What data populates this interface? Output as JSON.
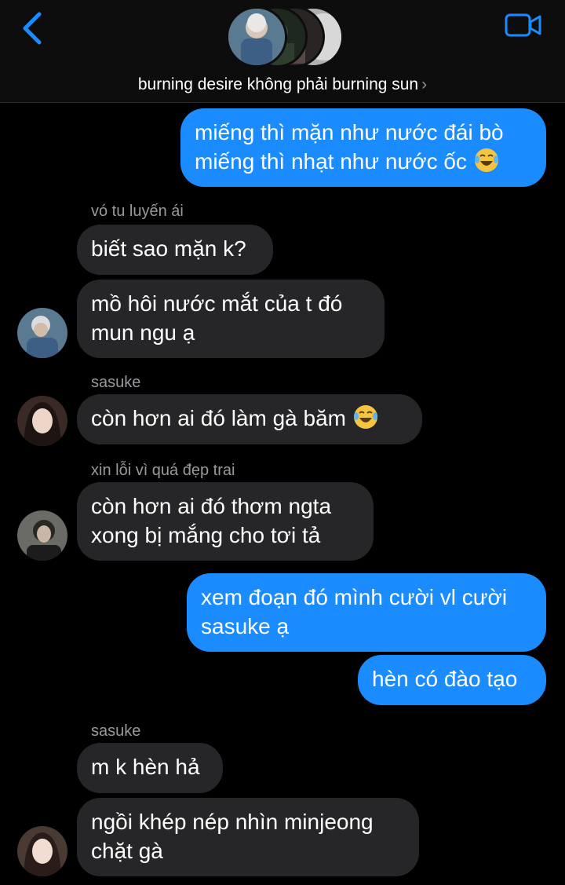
{
  "header": {
    "title": "burning desire không phải burning sun",
    "chevron": "›",
    "back_icon": "chevron-left-icon",
    "video_icon": "video-camera-icon",
    "accent": "#1a8cff"
  },
  "messages": [
    {
      "type": "sent",
      "lines": [
        "miếng thì mặn như nước đái bò",
        "miếng thì nhạt như nước ốc"
      ],
      "emoji": "laughing-tears-emoji"
    },
    {
      "type": "recv",
      "sender": "vó tu luyến ái",
      "text": "biết sao mặn k?"
    },
    {
      "type": "recv",
      "lines": [
        "mồ hôi nước mắt của t đó",
        "mun ngu ạ"
      ]
    },
    {
      "type": "recv",
      "sender": "sasuke",
      "text": "còn hơn ai đó làm gà băm",
      "emoji": "laughing-tears-emoji"
    },
    {
      "type": "recv",
      "sender": "xin lỗi vì quá đẹp trai",
      "lines": [
        "còn hơn ai đó thơm ngta",
        "xong bị mắng cho tơi tả"
      ]
    },
    {
      "type": "sent",
      "lines": [
        "xem đoạn đó mình cười vl cười",
        "sasuke ạ"
      ]
    },
    {
      "type": "sent",
      "text": "hèn có đào tạo"
    },
    {
      "type": "recv",
      "sender": "sasuke",
      "text": "m k hèn hả"
    },
    {
      "type": "recv",
      "lines": [
        "ngồi khép nép nhìn minjeong",
        "chặt gà"
      ]
    }
  ],
  "colors": {
    "sent_bubble": "#1a8cff",
    "recv_bubble": "#262628",
    "background": "#000000"
  }
}
